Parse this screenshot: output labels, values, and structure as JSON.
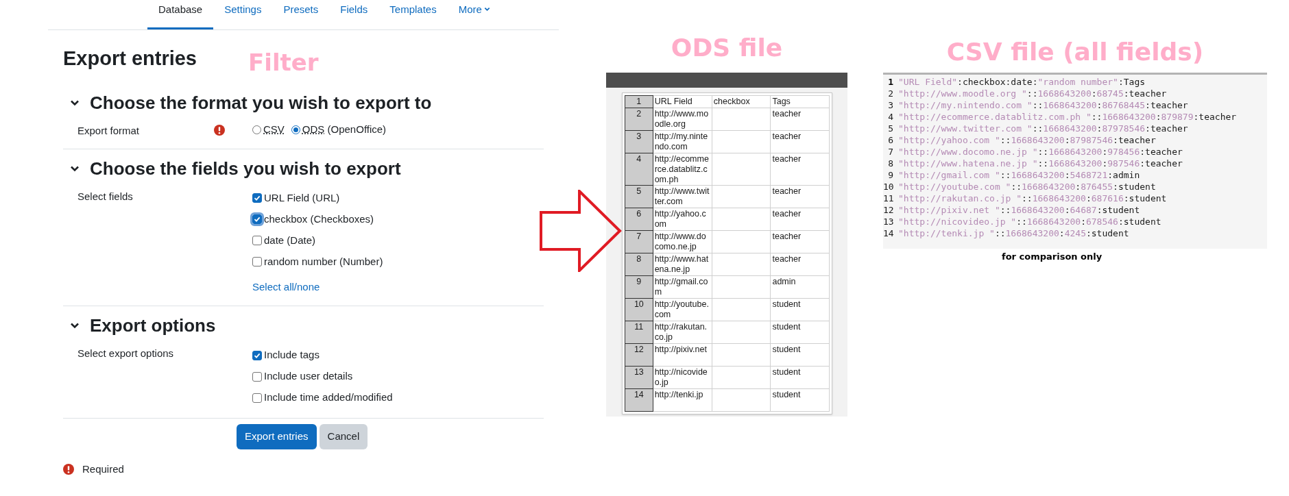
{
  "tabs": [
    {
      "label": "Database",
      "selected": true,
      "kind": "link"
    },
    {
      "label": "Settings",
      "selected": false,
      "kind": "link"
    },
    {
      "label": "Presets",
      "selected": false,
      "kind": "link"
    },
    {
      "label": "Fields",
      "selected": false,
      "kind": "link"
    },
    {
      "label": "Templates",
      "selected": false,
      "kind": "link"
    },
    {
      "label": "More",
      "selected": false,
      "kind": "menu"
    }
  ],
  "page_title": "Export entries",
  "filter_annotation": "Filter",
  "sections": [
    {
      "title": "Choose the format you wish to export to",
      "expanded": true,
      "rows": [
        {
          "label": "Export format",
          "required": true,
          "kind": "radio",
          "options": [
            {
              "label": "CSV",
              "selected": false
            },
            {
              "label": "ODS",
              "suffix": "(OpenOffice)",
              "selected": true
            }
          ]
        }
      ]
    },
    {
      "title": "Choose the fields you wish to export",
      "expanded": true,
      "rows": [
        {
          "label": "Select fields",
          "required": false,
          "kind": "checkbox",
          "options": [
            {
              "label": "URL Field (URL)",
              "checked": true,
              "focused": false
            },
            {
              "label": "checkbox (Checkboxes)",
              "checked": true,
              "focused": true
            },
            {
              "label": "date (Date)",
              "checked": false,
              "focused": false
            },
            {
              "label": "random number (Number)",
              "checked": false,
              "focused": false
            }
          ],
          "link": "Select all/none"
        }
      ]
    },
    {
      "title": "Export options",
      "expanded": true,
      "rows": [
        {
          "label": "Select export options",
          "required": false,
          "kind": "checkbox",
          "options": [
            {
              "label": "Include tags",
              "checked": true,
              "focused": false
            },
            {
              "label": "Include user details",
              "checked": false,
              "focused": false
            },
            {
              "label": "Include time added/modified",
              "checked": false,
              "focused": false
            }
          ]
        }
      ]
    }
  ],
  "buttons": [
    {
      "label": "Export entries",
      "kind": "primary"
    },
    {
      "label": "Cancel",
      "kind": "secondary"
    }
  ],
  "required_note": "Required",
  "ods": {
    "title": "ODS file",
    "rows": [
      {
        "number": "1",
        "cells": [
          "URL Field",
          "checkbox",
          "Tags"
        ]
      },
      {
        "number": "2",
        "cells": [
          "http://www.moodle.org",
          "",
          "teacher"
        ]
      },
      {
        "number": "3",
        "cells": [
          "http://my.nintendo.com",
          "",
          "teacher"
        ]
      },
      {
        "number": "4",
        "cells": [
          "http://ecommerce.datablitz.com.ph",
          "",
          "teacher"
        ]
      },
      {
        "number": "5",
        "cells": [
          "http://www.twitter.com",
          "",
          "teacher"
        ]
      },
      {
        "number": "6",
        "cells": [
          "http://yahoo.com",
          "",
          "teacher"
        ]
      },
      {
        "number": "7",
        "cells": [
          "http://www.docomo.ne.jp",
          "",
          "teacher"
        ]
      },
      {
        "number": "8",
        "cells": [
          "http://www.hatena.ne.jp",
          "",
          "teacher"
        ]
      },
      {
        "number": "9",
        "cells": [
          "http://gmail.com",
          "",
          "admin"
        ]
      },
      {
        "number": "10",
        "cells": [
          "http://youtube.com",
          "",
          "student"
        ]
      },
      {
        "number": "11",
        "cells": [
          "http://rakutan.co.jp",
          "",
          "student"
        ]
      },
      {
        "number": "12",
        "cells": [
          "http://pixiv.net",
          "",
          "student"
        ]
      },
      {
        "number": "13",
        "cells": [
          "http://nicovideo.jp",
          "",
          "student"
        ]
      },
      {
        "number": "14",
        "cells": [
          "http://tenki.jp",
          "",
          "student"
        ]
      }
    ]
  },
  "csv": {
    "title": "CSV file (all fields)",
    "note": "for comparison only",
    "lines": [
      {
        "number": "1",
        "tokens": [
          {
            "text": "\"URL Field\"",
            "kind": "string"
          },
          {
            "text": ":checkbox:date:",
            "kind": "plain"
          },
          {
            "text": "\"random number\"",
            "kind": "string"
          },
          {
            "text": ":Tags",
            "kind": "plain"
          }
        ]
      },
      {
        "number": "2",
        "tokens": [
          {
            "text": "\"http://www.moodle.org \"",
            "kind": "string"
          },
          {
            "text": "::",
            "kind": "plain"
          },
          {
            "text": "1668643200",
            "kind": "number"
          },
          {
            "text": ":",
            "kind": "plain"
          },
          {
            "text": "68745",
            "kind": "number"
          },
          {
            "text": ":teacher",
            "kind": "plain"
          }
        ]
      },
      {
        "number": "3",
        "tokens": [
          {
            "text": "\"http://my.nintendo.com \"",
            "kind": "string"
          },
          {
            "text": "::",
            "kind": "plain"
          },
          {
            "text": "1668643200",
            "kind": "number"
          },
          {
            "text": ":",
            "kind": "plain"
          },
          {
            "text": "86768445",
            "kind": "number"
          },
          {
            "text": ":teacher",
            "kind": "plain"
          }
        ]
      },
      {
        "number": "4",
        "tokens": [
          {
            "text": "\"http://ecommerce.datablitz.com.ph \"",
            "kind": "string"
          },
          {
            "text": "::",
            "kind": "plain"
          },
          {
            "text": "1668643200",
            "kind": "number"
          },
          {
            "text": ":",
            "kind": "plain"
          },
          {
            "text": "879879",
            "kind": "number"
          },
          {
            "text": ":teacher",
            "kind": "plain"
          }
        ]
      },
      {
        "number": "5",
        "tokens": [
          {
            "text": "\"http://www.twitter.com \"",
            "kind": "string"
          },
          {
            "text": "::",
            "kind": "plain"
          },
          {
            "text": "1668643200",
            "kind": "number"
          },
          {
            "text": ":",
            "kind": "plain"
          },
          {
            "text": "87978546",
            "kind": "number"
          },
          {
            "text": ":teacher",
            "kind": "plain"
          }
        ]
      },
      {
        "number": "6",
        "tokens": [
          {
            "text": "\"http://yahoo.com \"",
            "kind": "string"
          },
          {
            "text": "::",
            "kind": "plain"
          },
          {
            "text": "1668643200",
            "kind": "number"
          },
          {
            "text": ":",
            "kind": "plain"
          },
          {
            "text": "87987546",
            "kind": "number"
          },
          {
            "text": ":teacher",
            "kind": "plain"
          }
        ]
      },
      {
        "number": "7",
        "tokens": [
          {
            "text": "\"http://www.docomo.ne.jp \"",
            "kind": "string"
          },
          {
            "text": "::",
            "kind": "plain"
          },
          {
            "text": "1668643200",
            "kind": "number"
          },
          {
            "text": ":",
            "kind": "plain"
          },
          {
            "text": "978456",
            "kind": "number"
          },
          {
            "text": ":teacher",
            "kind": "plain"
          }
        ]
      },
      {
        "number": "8",
        "tokens": [
          {
            "text": "\"http://www.hatena.ne.jp \"",
            "kind": "string"
          },
          {
            "text": "::",
            "kind": "plain"
          },
          {
            "text": "1668643200",
            "kind": "number"
          },
          {
            "text": ":",
            "kind": "plain"
          },
          {
            "text": "987546",
            "kind": "number"
          },
          {
            "text": ":teacher",
            "kind": "plain"
          }
        ]
      },
      {
        "number": "9",
        "tokens": [
          {
            "text": "\"http://gmail.com \"",
            "kind": "string"
          },
          {
            "text": "::",
            "kind": "plain"
          },
          {
            "text": "1668643200",
            "kind": "number"
          },
          {
            "text": ":",
            "kind": "plain"
          },
          {
            "text": "5468721",
            "kind": "number"
          },
          {
            "text": ":admin",
            "kind": "plain"
          }
        ]
      },
      {
        "number": "10",
        "tokens": [
          {
            "text": "\"http://youtube.com \"",
            "kind": "string"
          },
          {
            "text": "::",
            "kind": "plain"
          },
          {
            "text": "1668643200",
            "kind": "number"
          },
          {
            "text": ":",
            "kind": "plain"
          },
          {
            "text": "876455",
            "kind": "number"
          },
          {
            "text": ":student",
            "kind": "plain"
          }
        ]
      },
      {
        "number": "11",
        "tokens": [
          {
            "text": "\"http://rakutan.co.jp \"",
            "kind": "string"
          },
          {
            "text": "::",
            "kind": "plain"
          },
          {
            "text": "1668643200",
            "kind": "number"
          },
          {
            "text": ":",
            "kind": "plain"
          },
          {
            "text": "687616",
            "kind": "number"
          },
          {
            "text": ":student",
            "kind": "plain"
          }
        ]
      },
      {
        "number": "12",
        "tokens": [
          {
            "text": "\"http://pixiv.net \"",
            "kind": "string"
          },
          {
            "text": "::",
            "kind": "plain"
          },
          {
            "text": "1668643200",
            "kind": "number"
          },
          {
            "text": ":",
            "kind": "plain"
          },
          {
            "text": "64687",
            "kind": "number"
          },
          {
            "text": ":student",
            "kind": "plain"
          }
        ]
      },
      {
        "number": "13",
        "tokens": [
          {
            "text": "\"http://nicovideo.jp \"",
            "kind": "string"
          },
          {
            "text": "::",
            "kind": "plain"
          },
          {
            "text": "1668643200",
            "kind": "number"
          },
          {
            "text": ":",
            "kind": "plain"
          },
          {
            "text": "678546",
            "kind": "number"
          },
          {
            "text": ":student",
            "kind": "plain"
          }
        ]
      },
      {
        "number": "14",
        "tokens": [
          {
            "text": "\"http://tenki.jp \"",
            "kind": "string"
          },
          {
            "text": "::",
            "kind": "plain"
          },
          {
            "text": "1668643200",
            "kind": "number"
          },
          {
            "text": ":",
            "kind": "plain"
          },
          {
            "text": "4245",
            "kind": "number"
          },
          {
            "text": ":student",
            "kind": "plain"
          }
        ]
      }
    ]
  }
}
